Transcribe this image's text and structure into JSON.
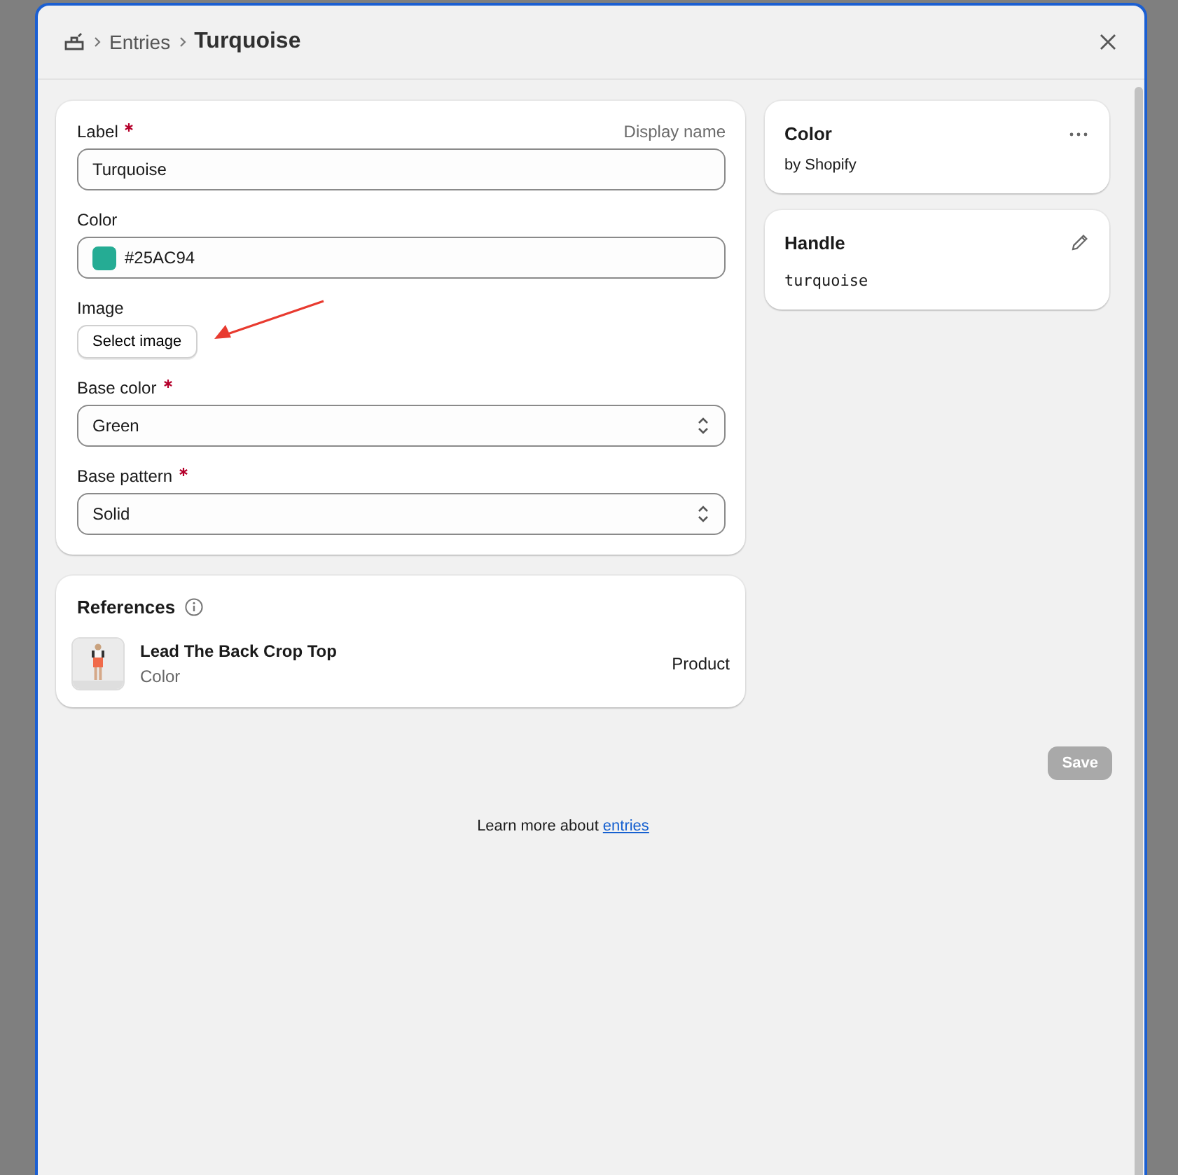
{
  "breadcrumb": {
    "parent": "Entries",
    "title": "Turquoise"
  },
  "form": {
    "fields": [
      {
        "kind": "text",
        "label": "Label",
        "required": true,
        "hint": "Display name",
        "value": "Turquoise"
      },
      {
        "kind": "color",
        "label": "Color",
        "required": false,
        "value": "#25AC94",
        "color": "#25ac94"
      },
      {
        "label": "Image",
        "required": false,
        "button": "Select image"
      },
      {
        "kind": "select",
        "label": "Base color",
        "required": true,
        "value": "Green"
      },
      {
        "kind": "select",
        "label": "Base pattern",
        "required": true,
        "value": "Solid"
      }
    ]
  },
  "references": {
    "title": "References",
    "items": [
      {
        "name": "Lead The Back Crop Top",
        "subtitle": "Color",
        "type": "Product"
      }
    ]
  },
  "definition_card": {
    "title": "Color",
    "subtitle": "by Shopify"
  },
  "handle_card": {
    "title": "Handle",
    "value": "turquoise"
  },
  "save_button": {
    "label": "Save",
    "disabled": true
  },
  "footer": {
    "text": "Learn more about",
    "link": "entries"
  }
}
